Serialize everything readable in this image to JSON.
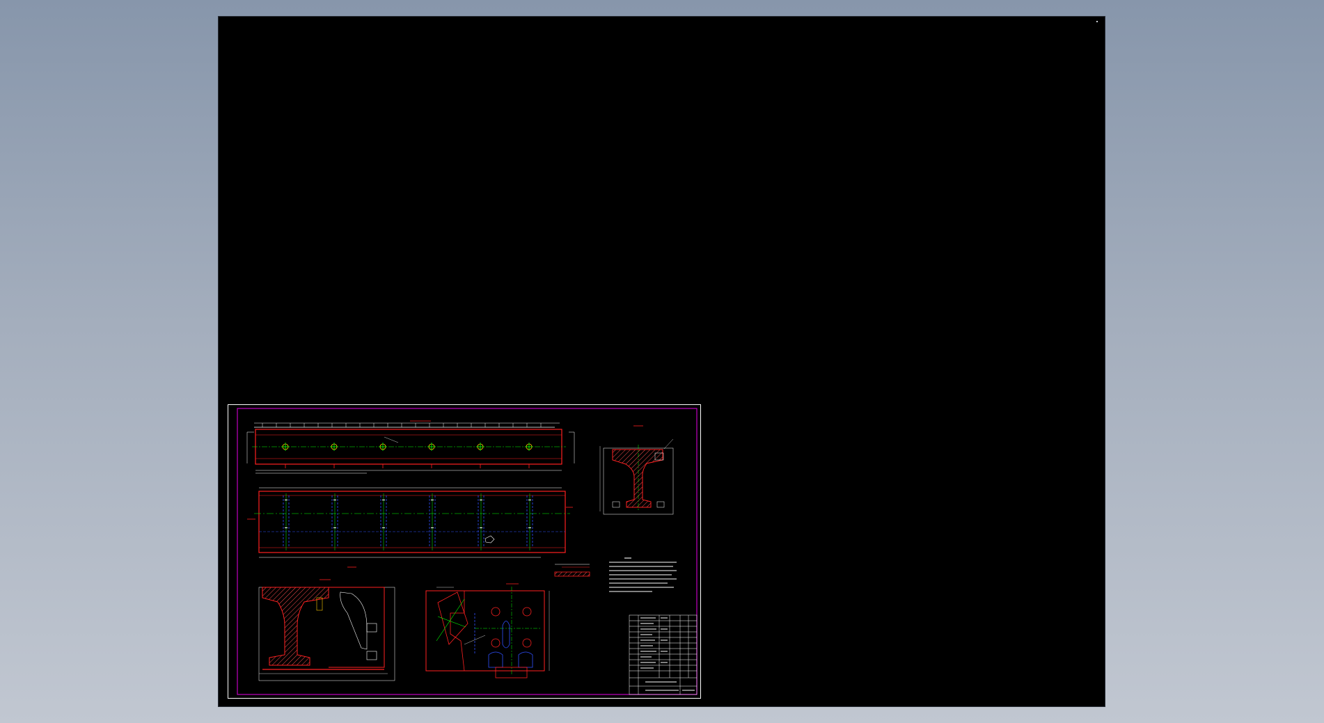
{
  "app": {
    "background_top": "#8796ab",
    "background_bottom": "#c1c7d1",
    "canvas_color": "#000000"
  },
  "drawing": {
    "sheet_border_color": "#ffffff",
    "frame_color": "#c000c0",
    "outline_color": "#ff2020",
    "centerline_color": "#00ff00",
    "hidden_line_color": "#3050ff",
    "hatch_color": "#ff5050",
    "dimension_color": "#ffffff",
    "bolt_marker_color": "#ffcc00",
    "views": [
      {
        "name": "top-view"
      },
      {
        "name": "front-view"
      },
      {
        "name": "section-a-a"
      },
      {
        "name": "section-b-b"
      },
      {
        "name": "end-detail"
      },
      {
        "name": "technical-notes"
      },
      {
        "name": "title-block"
      }
    ]
  }
}
